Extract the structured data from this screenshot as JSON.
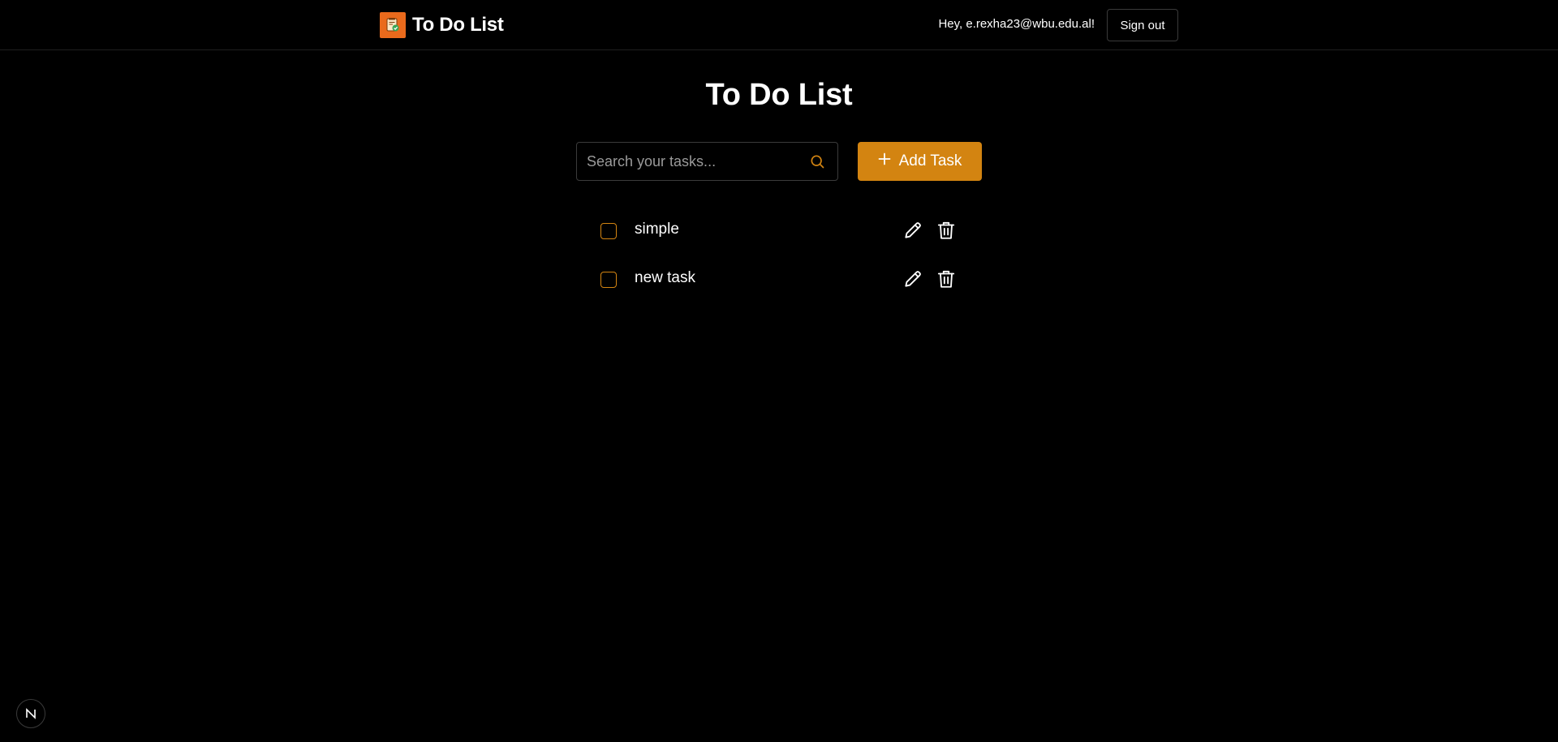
{
  "header": {
    "brand_title": "To Do List",
    "greeting": "Hey, e.rexha23@wbu.edu.al!",
    "signout_label": "Sign out"
  },
  "main": {
    "title": "To Do List",
    "search": {
      "placeholder": "Search your tasks...",
      "value": ""
    },
    "add_label": "Add Task",
    "tasks": [
      {
        "label": "simple",
        "completed": false
      },
      {
        "label": "new task",
        "completed": false
      }
    ]
  },
  "dev_badge": {
    "label": "N"
  },
  "colors": {
    "background": "#000000",
    "accent": "#d38411",
    "logo": "#ea6a1c",
    "text": "#ffffff"
  },
  "icons": {
    "logo": "notepad-check-icon",
    "search": "search-icon",
    "add": "plus-icon",
    "edit": "pencil-icon",
    "delete": "trash-icon"
  }
}
